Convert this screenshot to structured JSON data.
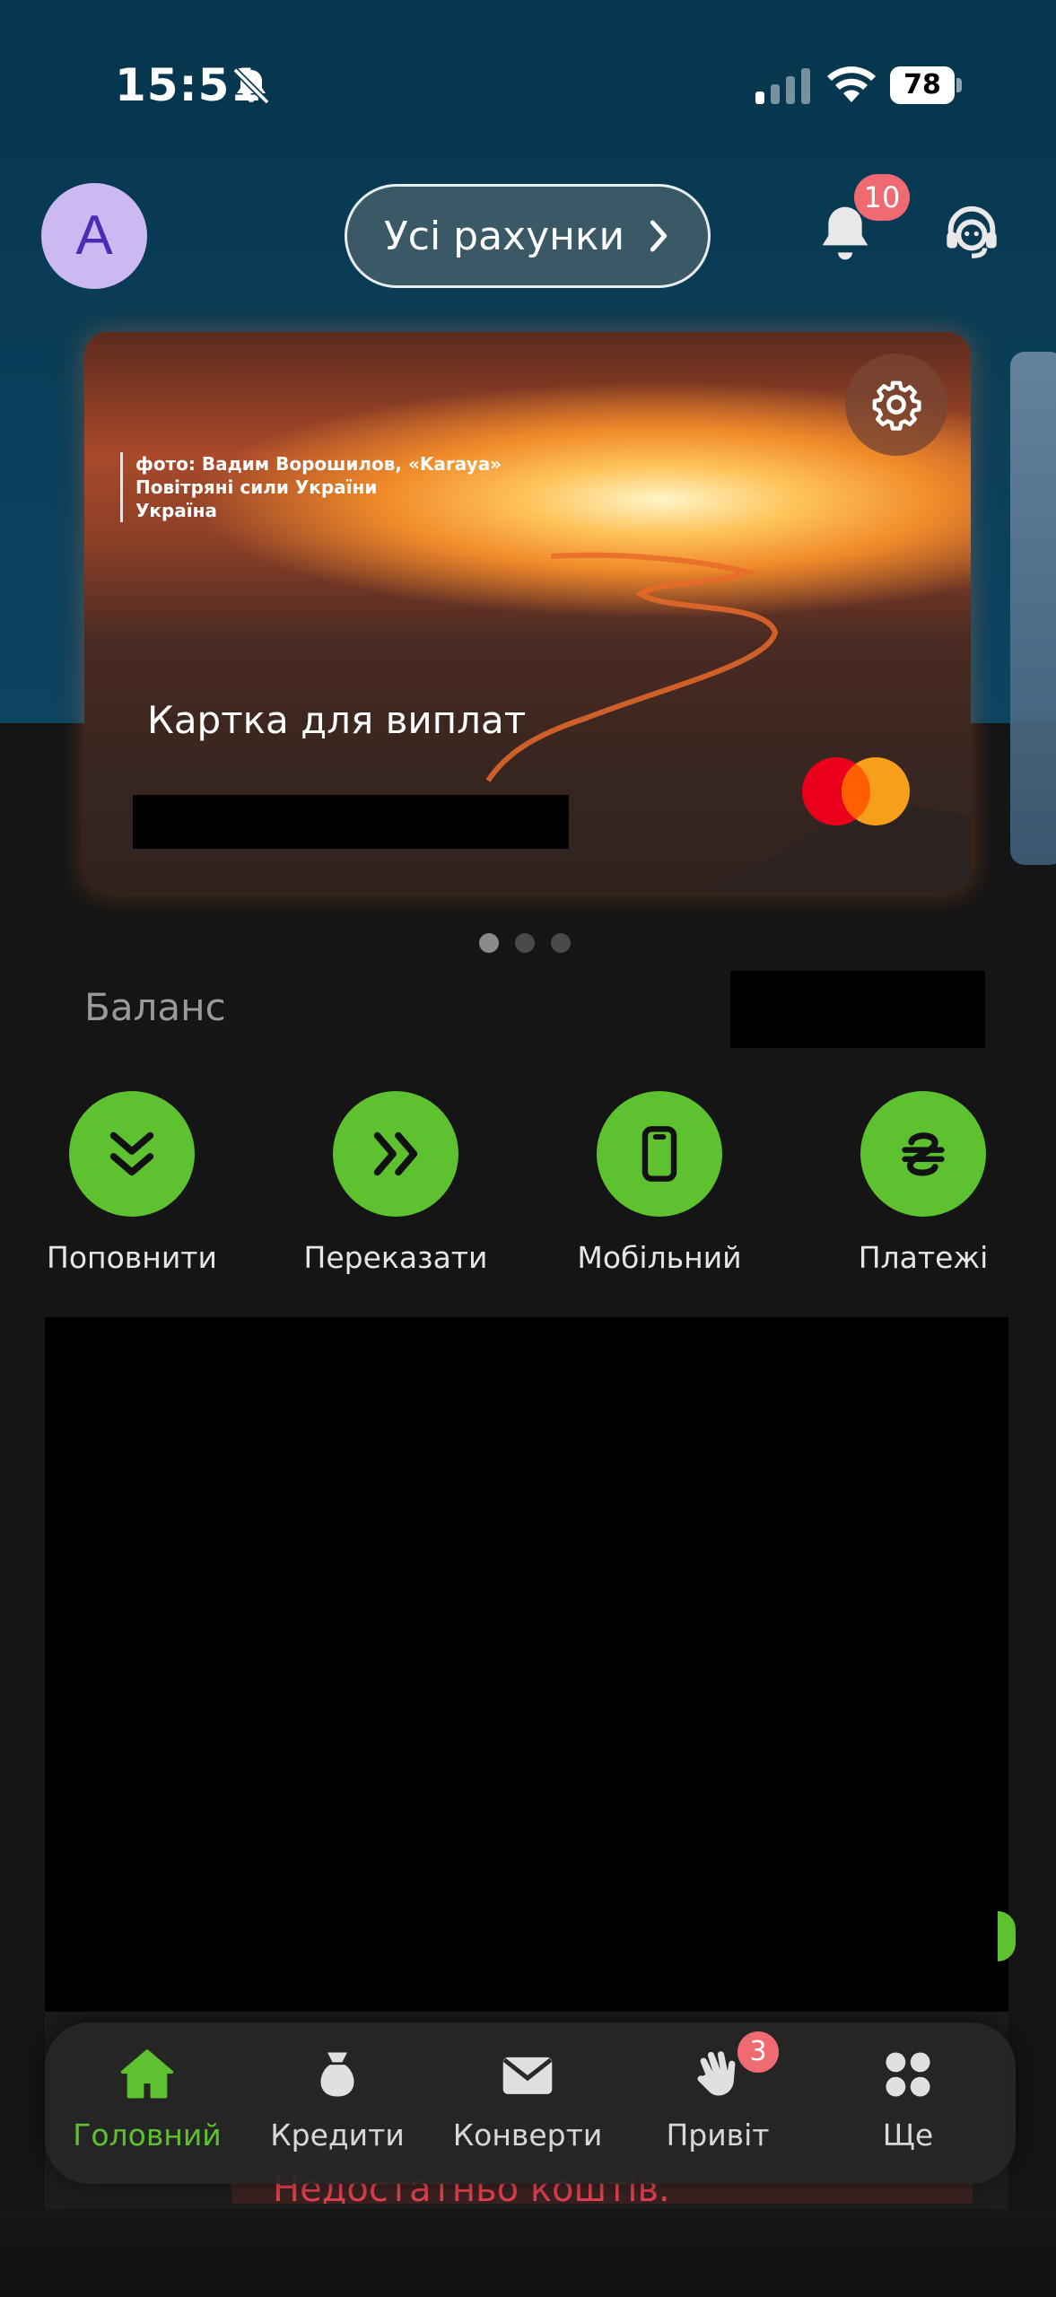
{
  "status_bar": {
    "time": "15:51",
    "battery": "78"
  },
  "header": {
    "avatar_letter": "A",
    "accounts_label": "Усі рахунки",
    "notifications_count": "10"
  },
  "card": {
    "photo_credit": [
      "фото: Вадим Ворошилов, «Karaya»",
      "Повітряні сили України",
      "Україна"
    ],
    "title": "Картка для виплат",
    "pager": {
      "count": 3,
      "active": 1
    }
  },
  "balance": {
    "label": "Баланс"
  },
  "actions": [
    {
      "label": "Поповнити",
      "icon": "chevrons-down-icon"
    },
    {
      "label": "Переказати",
      "icon": "chevrons-right-icon"
    },
    {
      "label": "Мобільний",
      "icon": "mobile-phone-icon"
    },
    {
      "label": "Платежі",
      "icon": "hryvnia-icon"
    }
  ],
  "behind_content": {
    "error_text": "Недостатньо коштів."
  },
  "tabbar": {
    "items": [
      {
        "label": "Головний",
        "icon": "home-icon",
        "active": true
      },
      {
        "label": "Кредити",
        "icon": "money-bag-icon"
      },
      {
        "label": "Конверти",
        "icon": "envelope-icon"
      },
      {
        "label": "Привіт",
        "icon": "waving-hand-icon",
        "badge": "3"
      },
      {
        "label": "Ще",
        "icon": "grid-dots-icon"
      }
    ]
  },
  "colors": {
    "accent_green": "#5ec12f",
    "badge_red": "#f06a72",
    "header_blue": "#0b3e58"
  }
}
